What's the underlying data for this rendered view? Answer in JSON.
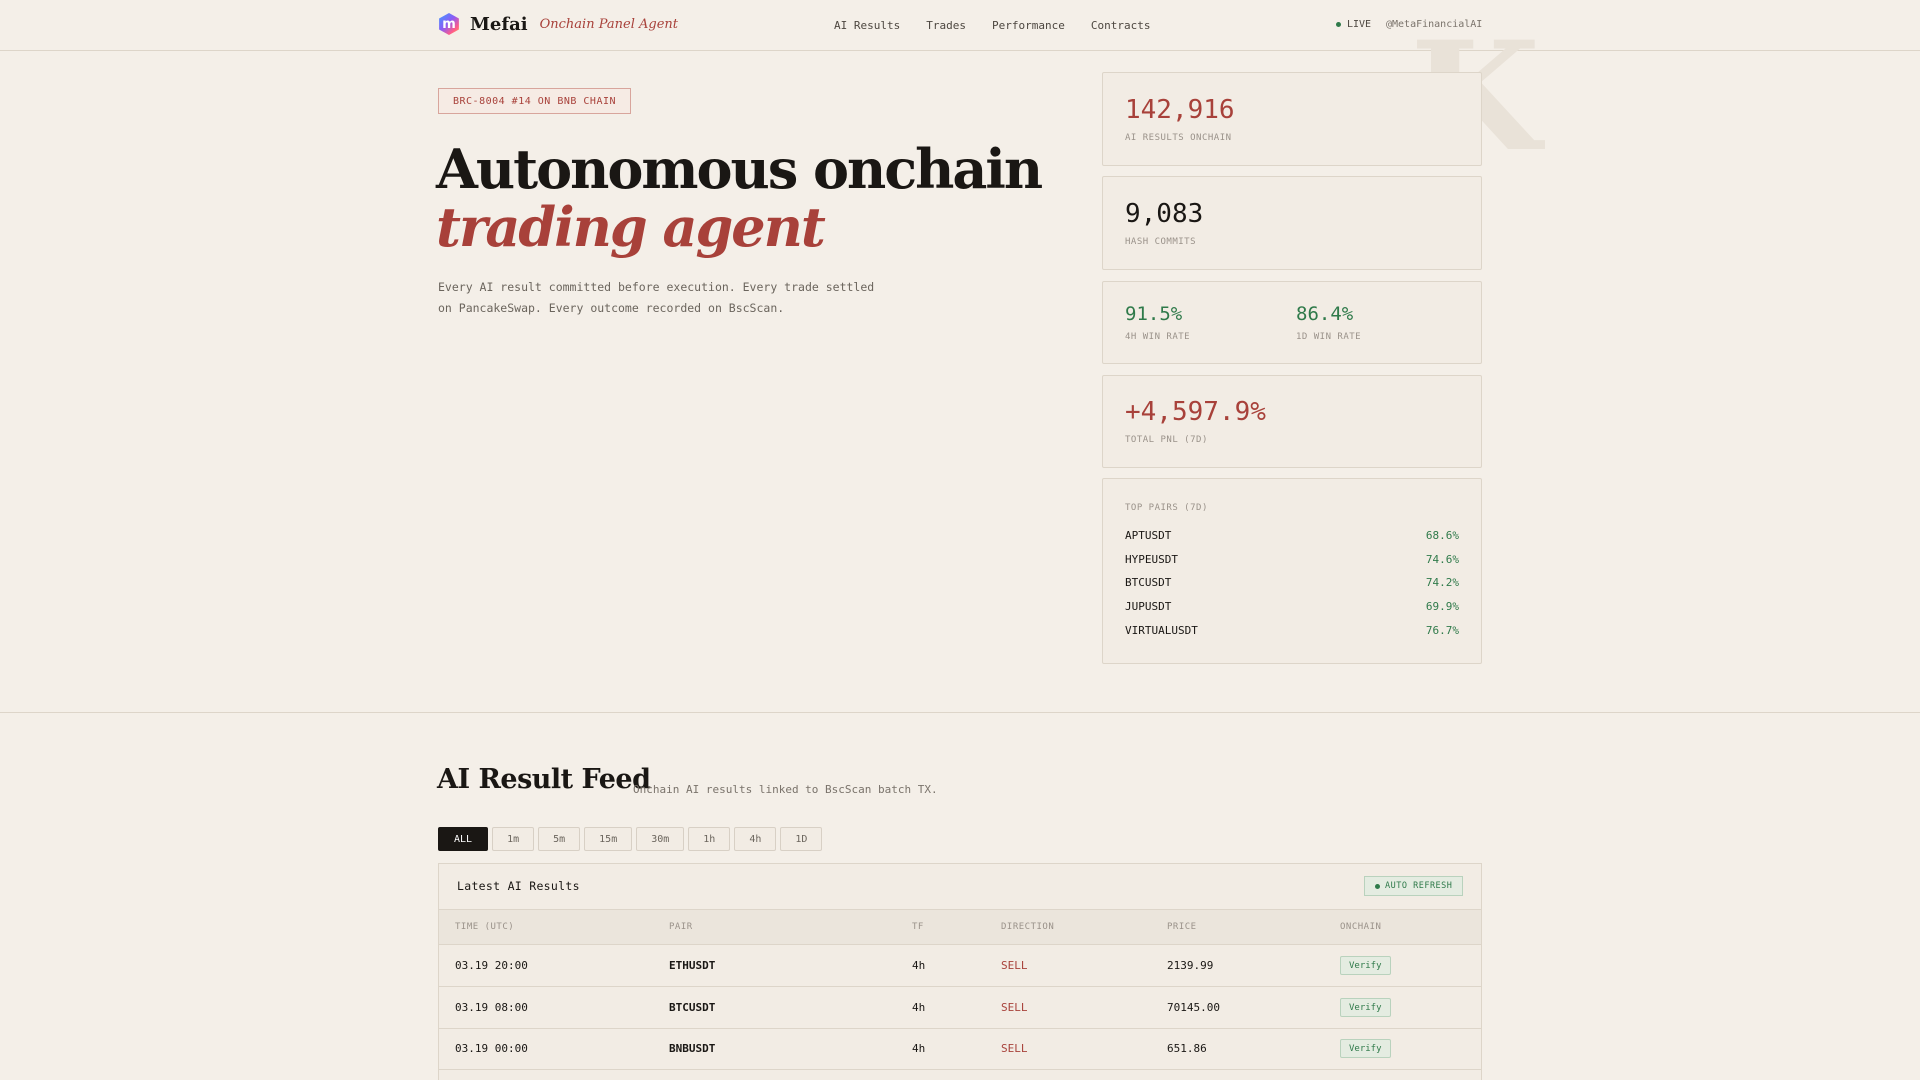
{
  "header": {
    "brand_letter": "m",
    "brand_name": "Mefai",
    "brand_sub": "Onchain Panel Agent",
    "nav": [
      "AI Results",
      "Trades",
      "Performance",
      "Contracts"
    ],
    "live": "LIVE",
    "handle": "@MetaFinancialAI"
  },
  "hero": {
    "badge": "BRC-8004 #14 ON BNB CHAIN",
    "title_line1": "Autonomous onchain",
    "title_line2": "trading agent",
    "description": "Every AI result committed before execution. Every trade settled on PancakeSwap. Every outcome recorded on BscScan."
  },
  "stats": {
    "ai_results": {
      "value": "142,916",
      "label": "AI RESULTS ONCHAIN"
    },
    "hash_commits": {
      "value": "9,083",
      "label": "HASH COMMITS"
    },
    "win_4h": {
      "value": "91.5%",
      "label": "4H WIN RATE"
    },
    "win_1d": {
      "value": "86.4%",
      "label": "1D WIN RATE"
    },
    "pnl": {
      "value": "+4,597.9%",
      "label": "TOTAL PNL (7D)"
    }
  },
  "top_pairs": {
    "title": "TOP PAIRS (7D)",
    "rows": [
      {
        "pair": "APTUSDT",
        "rate": "68.6%"
      },
      {
        "pair": "HYPEUSDT",
        "rate": "74.6%"
      },
      {
        "pair": "BTCUSDT",
        "rate": "74.2%"
      },
      {
        "pair": "JUPUSDT",
        "rate": "69.9%"
      },
      {
        "pair": "VIRTUALUSDT",
        "rate": "76.7%"
      }
    ]
  },
  "feed": {
    "title": "AI Result Feed",
    "subtitle": "Onchain AI results linked to BscScan batch TX.",
    "filters": [
      "ALL",
      "1m",
      "5m",
      "15m",
      "30m",
      "1h",
      "4h",
      "1D"
    ],
    "active_filter": "ALL",
    "table_title": "Latest AI Results",
    "auto_refresh": "AUTO REFRESH",
    "columns": [
      "TIME (UTC)",
      "PAIR",
      "TF",
      "DIRECTION",
      "PRICE",
      "ONCHAIN"
    ],
    "rows": [
      {
        "time": "03.19 20:00",
        "pair": "ETHUSDT",
        "tf": "4h",
        "direction": "SELL",
        "price": "2139.99",
        "action": "Verify"
      },
      {
        "time": "03.19 08:00",
        "pair": "BTCUSDT",
        "tf": "4h",
        "direction": "SELL",
        "price": "70145.00",
        "action": "Verify"
      },
      {
        "time": "03.19 00:00",
        "pair": "BNBUSDT",
        "tf": "4h",
        "direction": "SELL",
        "price": "651.86",
        "action": "Verify"
      }
    ]
  },
  "colors": {
    "background": "#f4efe8",
    "accent_red": "#a8413a",
    "accent_green": "#2f7a4a",
    "ink": "#1a1714"
  }
}
